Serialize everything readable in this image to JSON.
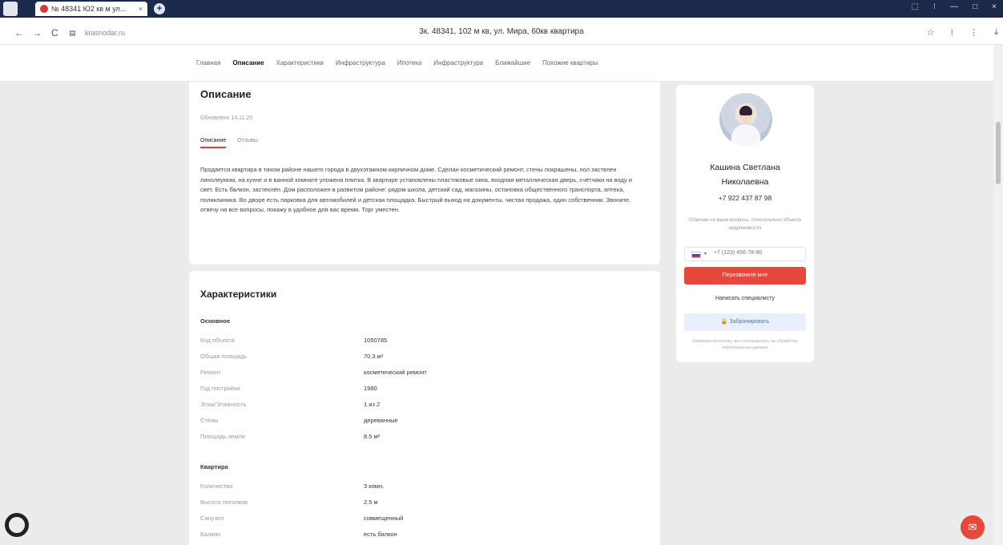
{
  "browser": {
    "tab_title": "№ 48341 Ю2 кв м ул...",
    "tab_close": "×",
    "new_tab": "+",
    "window_controls": [
      "⬚",
      "⁝",
      "—",
      "□",
      "×"
    ],
    "url": "krasnodar.ru",
    "page_title": "3к. 48341, 102 м кв, ул. Мира, 60кв квартира",
    "nav_back": "←",
    "nav_forward": "→",
    "nav_reload": "C",
    "toolbar_icons": [
      "☆",
      "⁝",
      "⋮",
      "⤓"
    ]
  },
  "site_nav": {
    "items": [
      "Главная",
      "Описание",
      "Характеристики",
      "Инфраструктура",
      "Ипотека",
      "Инфраструктура",
      "Ближайшие",
      "Похожие квартиры"
    ],
    "active_index": 1
  },
  "description": {
    "title": "Описание",
    "subtitle": "Обновлено 14.11.20",
    "tabs": [
      "Описание",
      "Отзывы"
    ],
    "text": "Продается квартира в тихом районе нашего города в двухэтажном кирпичном доме. Сделан косметический ремонт, стены покрашены, пол застелен линолеумом, на кухне и в ванной комнате уложена плитка. В квартире установлены пластиковые окна, входная металлическая дверь, счётчики на воду и свет. Есть балкон, застеклён. Дом расположен в развитом районе: рядом школа, детский сад, магазины, остановка общественного транспорта, аптека, поликлиника. Во дворе есть парковка для автомобилей и детская площадка. Быстрый выход на документы, чистая продажа, один собственник. Звоните, отвечу на все вопросы, покажу в удобное для вас время. Торг уместен."
  },
  "characteristics": {
    "title": "Характеристики",
    "sections": [
      {
        "label": "Основное",
        "rows": [
          {
            "k": "Код объекта",
            "v": "1050785"
          },
          {
            "k": "Общая площадь",
            "v": "70.3 м²"
          },
          {
            "k": "Ремонт",
            "v": "косметический ремонт"
          },
          {
            "k": "Год постройки",
            "v": "1980"
          },
          {
            "k": "Этаж/Этажность",
            "v": "1 из 2"
          },
          {
            "k": "Стены",
            "v": "деревянные"
          },
          {
            "k": "Площадь земли",
            "v": "8.5 м²"
          }
        ]
      },
      {
        "label": "Квартира",
        "rows": [
          {
            "k": "Количество",
            "v": "3 комн."
          },
          {
            "k": "Высота потолков",
            "v": "2.5 м"
          },
          {
            "k": "Санузел",
            "v": "совмещенный"
          },
          {
            "k": "Балкон",
            "v": "есть балкон"
          }
        ]
      }
    ]
  },
  "agent": {
    "name_line1": "Кашина Светлана",
    "name_line2": "Николаевна",
    "phone": "+7 922 437 87 98",
    "note": "Отвечаю на ваши вопросы, относительно объекта недвижимости",
    "phone_placeholder": "+7 (123) 456-78-90",
    "flag_chevron": "▾",
    "call_button": "Перезвоните мне",
    "callback_button": "Написать специалисту",
    "book_button": "Забронировать",
    "fine_print": "Нажимая на кнопку, вы соглашаетесь на обработку персональных данных",
    "book_icon": "🔒"
  },
  "floating": {
    "fab_icon": "chat-icon",
    "fab_glyph": "✉"
  }
}
